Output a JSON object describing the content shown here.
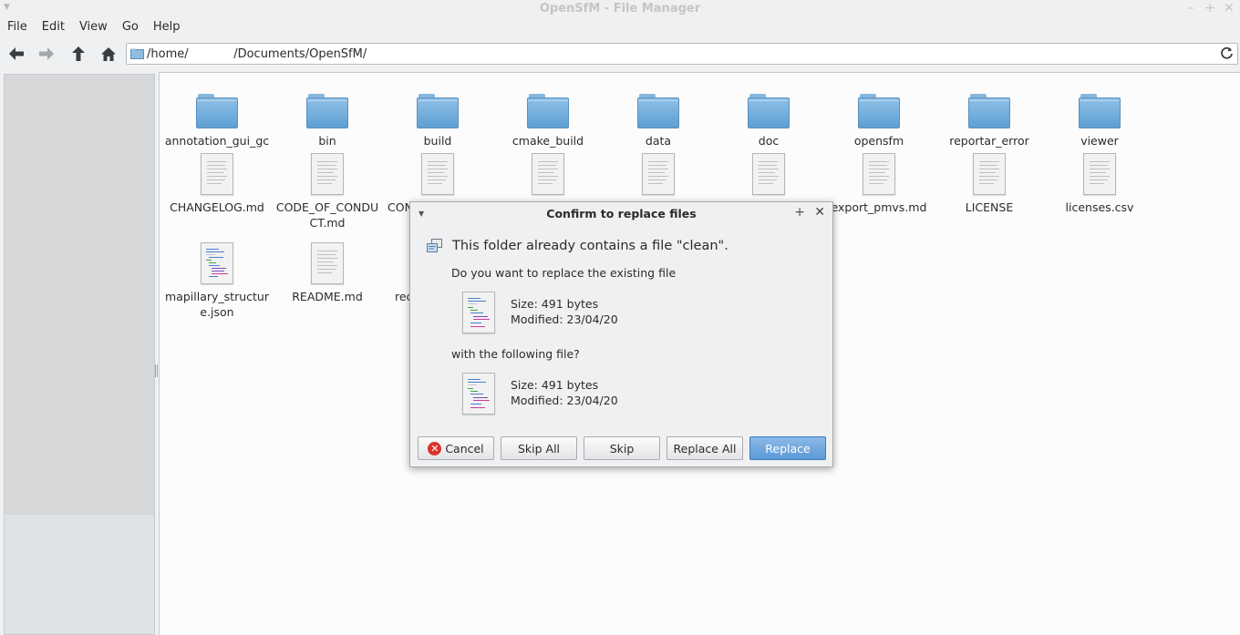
{
  "window": {
    "title": "OpenSfM - File Manager"
  },
  "menubar": {
    "items": [
      "File",
      "Edit",
      "View",
      "Go",
      "Help"
    ]
  },
  "toolbar": {
    "path": "/home/            /Documents/OpenSfM/"
  },
  "icons": {
    "back": "arrow-left-icon",
    "forward": "arrow-right-icon",
    "up": "arrow-up-icon",
    "home": "home-icon",
    "reload": "reload-icon"
  },
  "files": [
    {
      "name": "annotation_gui_gcp",
      "type": "folder"
    },
    {
      "name": "bin",
      "type": "folder"
    },
    {
      "name": "build",
      "type": "folder"
    },
    {
      "name": "cmake_build",
      "type": "folder"
    },
    {
      "name": "data",
      "type": "folder"
    },
    {
      "name": "doc",
      "type": "folder"
    },
    {
      "name": "opensfm",
      "type": "folder"
    },
    {
      "name": "reportar_error",
      "type": "folder"
    },
    {
      "name": "viewer",
      "type": "folder"
    },
    {
      "name": "CHANGELOG.md",
      "type": "text"
    },
    {
      "name": "CODE_OF_CONDUCT.md",
      "type": "text"
    },
    {
      "name": "CON",
      "type": "text"
    },
    {
      "name": "",
      "type": "text"
    },
    {
      "name": "",
      "type": "text"
    },
    {
      "name": "",
      "type": "text"
    },
    {
      "name": "export_pmvs.md",
      "type": "text"
    },
    {
      "name": "LICENSE",
      "type": "text"
    },
    {
      "name": "licenses.csv",
      "type": "text"
    },
    {
      "name": "mapillary_structure.json",
      "type": "code"
    },
    {
      "name": "README.md",
      "type": "text"
    },
    {
      "name": "rec",
      "type": "text"
    }
  ],
  "dialog": {
    "title": "Confirm to replace files",
    "heading": "This folder already contains a file \"clean\".",
    "question_existing": "Do you want to replace the existing file",
    "existing_size": "Size: 491 bytes",
    "existing_modified": "Modified: 23/04/20",
    "question_new": "with the following file?",
    "new_size": "Size: 491 bytes",
    "new_modified": "Modified: 23/04/20",
    "buttons": {
      "cancel": "Cancel",
      "skip_all": "Skip All",
      "skip": "Skip",
      "replace_all": "Replace All",
      "replace": "Replace"
    }
  },
  "colors": {
    "accent": "#5d99d6",
    "folder": "#6aa9da",
    "cancel_red": "#d9342b"
  }
}
